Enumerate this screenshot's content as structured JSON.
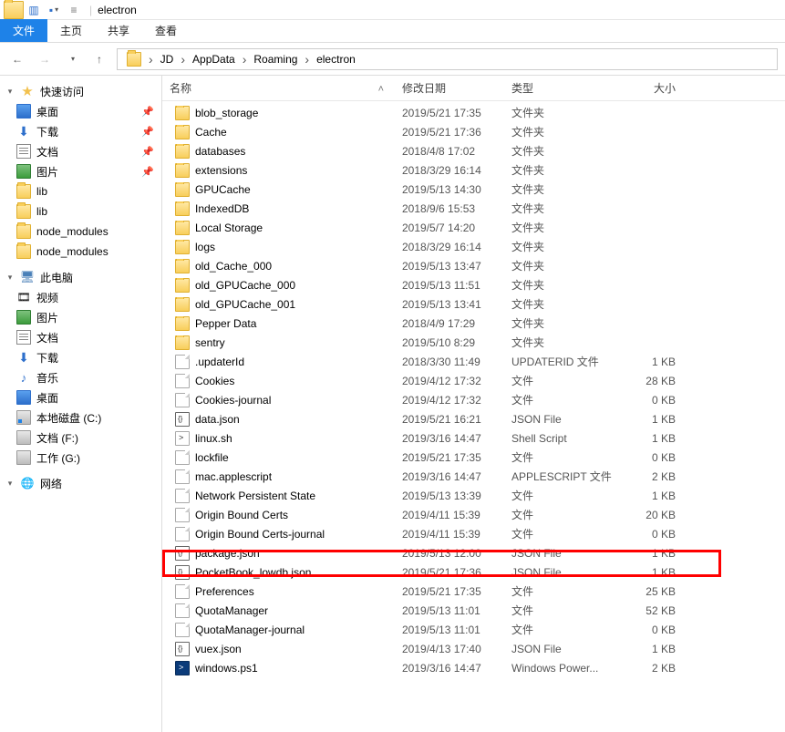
{
  "window": {
    "title": "electron"
  },
  "ribbon": {
    "file": "文件",
    "tabs": [
      "主页",
      "共享",
      "查看"
    ]
  },
  "navbar": {
    "crumbs": [
      "JD",
      "AppData",
      "Roaming",
      "electron"
    ]
  },
  "tree": {
    "quick": {
      "label": "快速访问",
      "items": [
        {
          "label": "桌面",
          "icon": "desktop",
          "pin": true
        },
        {
          "label": "下载",
          "icon": "dl",
          "pin": true
        },
        {
          "label": "文档",
          "icon": "doc",
          "pin": true
        },
        {
          "label": "图片",
          "icon": "pic",
          "pin": true
        },
        {
          "label": "lib",
          "icon": "folder",
          "pin": false
        },
        {
          "label": "lib",
          "icon": "folder",
          "pin": false
        },
        {
          "label": "node_modules",
          "icon": "folder",
          "pin": false
        },
        {
          "label": "node_modules",
          "icon": "folder",
          "pin": false
        }
      ]
    },
    "pc": {
      "label": "此电脑",
      "items": [
        {
          "label": "视频",
          "icon": "video"
        },
        {
          "label": "图片",
          "icon": "pic"
        },
        {
          "label": "文档",
          "icon": "doc"
        },
        {
          "label": "下载",
          "icon": "dl"
        },
        {
          "label": "音乐",
          "icon": "music"
        },
        {
          "label": "桌面",
          "icon": "desktop"
        },
        {
          "label": "本地磁盘 (C:)",
          "icon": "disk sys"
        },
        {
          "label": "文档 (F:)",
          "icon": "disk"
        },
        {
          "label": "工作 (G:)",
          "icon": "disk"
        }
      ]
    },
    "net": {
      "label": "网络"
    }
  },
  "columns": {
    "name": "名称",
    "date": "修改日期",
    "type": "类型",
    "size": "大小"
  },
  "files": [
    {
      "i": "folder",
      "n": "blob_storage",
      "d": "2019/5/21 17:35",
      "t": "文件夹",
      "s": ""
    },
    {
      "i": "folder",
      "n": "Cache",
      "d": "2019/5/21 17:36",
      "t": "文件夹",
      "s": ""
    },
    {
      "i": "folder",
      "n": "databases",
      "d": "2018/4/8 17:02",
      "t": "文件夹",
      "s": ""
    },
    {
      "i": "folder",
      "n": "extensions",
      "d": "2018/3/29 16:14",
      "t": "文件夹",
      "s": ""
    },
    {
      "i": "folder",
      "n": "GPUCache",
      "d": "2019/5/13 14:30",
      "t": "文件夹",
      "s": ""
    },
    {
      "i": "folder",
      "n": "IndexedDB",
      "d": "2018/9/6 15:53",
      "t": "文件夹",
      "s": ""
    },
    {
      "i": "folder",
      "n": "Local Storage",
      "d": "2019/5/7 14:20",
      "t": "文件夹",
      "s": ""
    },
    {
      "i": "folder",
      "n": "logs",
      "d": "2018/3/29 16:14",
      "t": "文件夹",
      "s": ""
    },
    {
      "i": "folder",
      "n": "old_Cache_000",
      "d": "2019/5/13 13:47",
      "t": "文件夹",
      "s": ""
    },
    {
      "i": "folder",
      "n": "old_GPUCache_000",
      "d": "2019/5/13 11:51",
      "t": "文件夹",
      "s": ""
    },
    {
      "i": "folder",
      "n": "old_GPUCache_001",
      "d": "2019/5/13 13:41",
      "t": "文件夹",
      "s": ""
    },
    {
      "i": "folder",
      "n": "Pepper Data",
      "d": "2018/4/9 17:29",
      "t": "文件夹",
      "s": ""
    },
    {
      "i": "folder",
      "n": "sentry",
      "d": "2019/5/10 8:29",
      "t": "文件夹",
      "s": ""
    },
    {
      "i": "file",
      "n": ".updaterId",
      "d": "2018/3/30 11:49",
      "t": "UPDATERID 文件",
      "s": "1 KB"
    },
    {
      "i": "file",
      "n": "Cookies",
      "d": "2019/4/12 17:32",
      "t": "文件",
      "s": "28 KB"
    },
    {
      "i": "file",
      "n": "Cookies-journal",
      "d": "2019/4/12 17:32",
      "t": "文件",
      "s": "0 KB"
    },
    {
      "i": "json",
      "n": "data.json",
      "d": "2019/5/21 16:21",
      "t": "JSON File",
      "s": "1 KB"
    },
    {
      "i": "sh",
      "n": "linux.sh",
      "d": "2019/3/16 14:47",
      "t": "Shell Script",
      "s": "1 KB"
    },
    {
      "i": "file",
      "n": "lockfile",
      "d": "2019/5/21 17:35",
      "t": "文件",
      "s": "0 KB"
    },
    {
      "i": "file",
      "n": "mac.applescript",
      "d": "2019/3/16 14:47",
      "t": "APPLESCRIPT 文件",
      "s": "2 KB"
    },
    {
      "i": "file",
      "n": "Network Persistent State",
      "d": "2019/5/13 13:39",
      "t": "文件",
      "s": "1 KB"
    },
    {
      "i": "file",
      "n": "Origin Bound Certs",
      "d": "2019/4/11 15:39",
      "t": "文件",
      "s": "20 KB"
    },
    {
      "i": "file",
      "n": "Origin Bound Certs-journal",
      "d": "2019/4/11 15:39",
      "t": "文件",
      "s": "0 KB"
    },
    {
      "i": "json",
      "n": "package.json",
      "d": "2019/5/13 12:00",
      "t": "JSON File",
      "s": "1 KB"
    },
    {
      "i": "json",
      "n": "PocketBook_lowdb.json",
      "d": "2019/5/21 17:36",
      "t": "JSON File",
      "s": "1 KB",
      "hl": true
    },
    {
      "i": "file",
      "n": "Preferences",
      "d": "2019/5/21 17:35",
      "t": "文件",
      "s": "25 KB"
    },
    {
      "i": "file",
      "n": "QuotaManager",
      "d": "2019/5/13 11:01",
      "t": "文件",
      "s": "52 KB"
    },
    {
      "i": "file",
      "n": "QuotaManager-journal",
      "d": "2019/5/13 11:01",
      "t": "文件",
      "s": "0 KB"
    },
    {
      "i": "json",
      "n": "vuex.json",
      "d": "2019/4/13 17:40",
      "t": "JSON File",
      "s": "1 KB"
    },
    {
      "i": "ps1",
      "n": "windows.ps1",
      "d": "2019/3/16 14:47",
      "t": "Windows Power...",
      "s": "2 KB"
    }
  ]
}
